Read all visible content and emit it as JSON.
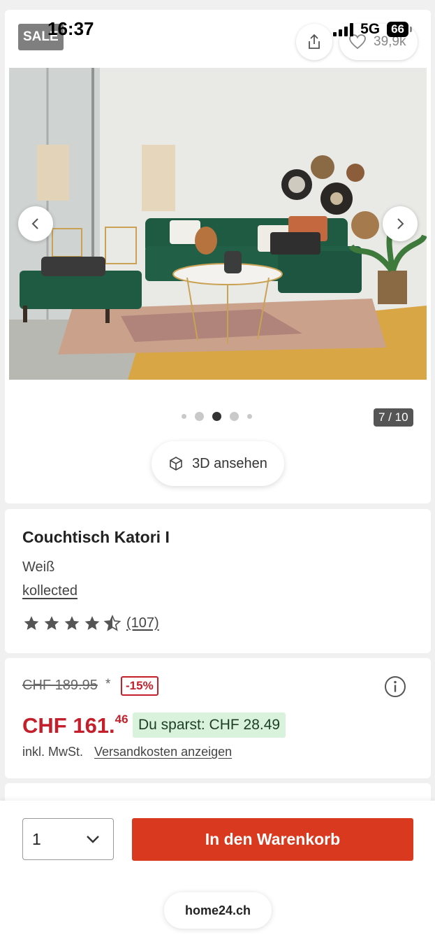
{
  "status": {
    "time": "16:37",
    "network": "5G",
    "battery": "66"
  },
  "gallery": {
    "sale_badge": "SALE",
    "like_count": "39,9k",
    "counter": "7 / 10",
    "dots_active_index": 2,
    "view_3d_label": "3D ansehen"
  },
  "product": {
    "title": "Couchtisch Katori I",
    "color": "Weiß",
    "brand": "kollected",
    "rating": 4.5,
    "review_count": "(107)"
  },
  "pricing": {
    "old_price": "CHF 189.95",
    "asterisk": "*",
    "discount": "-15%",
    "price_main": "CHF 161.",
    "price_cents": "46",
    "savings": "Du sparst: CHF 28.49",
    "vat_note": "inkl. MwSt.",
    "shipping_link": "Versandkosten anzeigen"
  },
  "cart": {
    "quantity": "1",
    "add_to_cart_label": "In den Warenkorb"
  },
  "browser": {
    "url": "home24.ch"
  },
  "colors": {
    "accent_red": "#c4202c",
    "cart_button": "#d9391e",
    "savings_bg": "#d9f2dc",
    "sofa_green": "#1f5a43"
  }
}
